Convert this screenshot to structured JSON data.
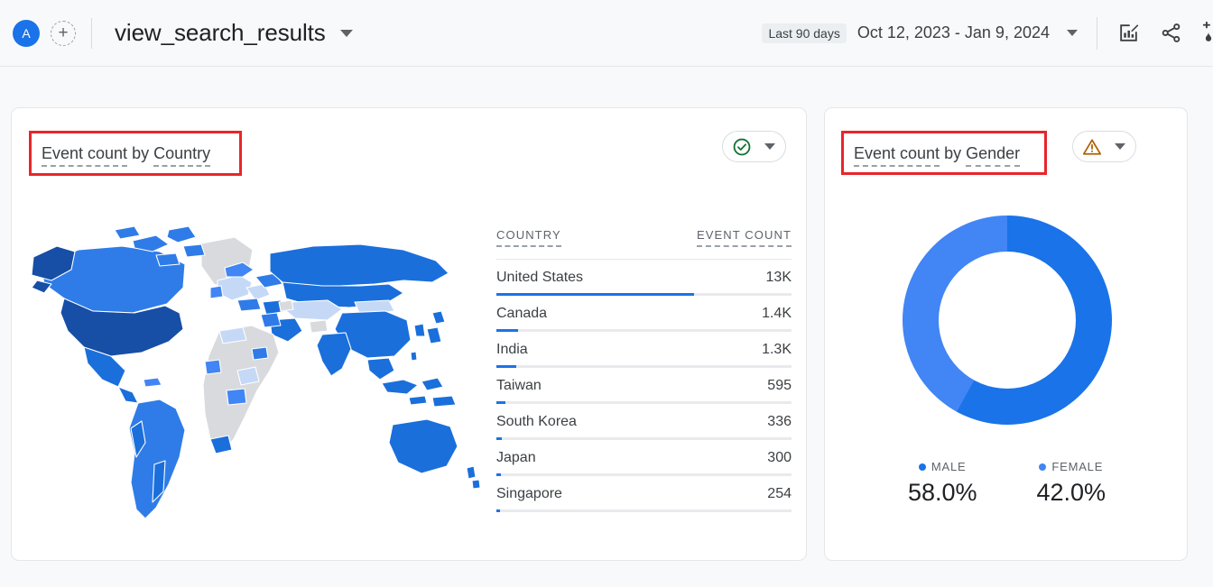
{
  "topbar": {
    "avatar_letter": "A",
    "add_icon": "plus-icon",
    "report_title": "view_search_results",
    "title_caret_icon": "chevron-down-icon",
    "date_badge": "Last 90 days",
    "date_range": "Oct 12, 2023 - Jan 9, 2024",
    "date_caret_icon": "chevron-down-icon",
    "icons": [
      "edit-chart-icon",
      "share-icon",
      "insights-icon"
    ]
  },
  "country_card": {
    "title_part1": "Event count",
    "title_mid": " by ",
    "title_part2": "Country",
    "status_icon": "check-circle-icon",
    "status_color": "#137333",
    "status_caret_icon": "chevron-down-icon",
    "table": {
      "headers": [
        "COUNTRY",
        "EVENT COUNT"
      ],
      "rows": [
        {
          "country": "United States",
          "value": "13K",
          "pct": 67
        },
        {
          "country": "Canada",
          "value": "1.4K",
          "pct": 7.2
        },
        {
          "country": "India",
          "value": "1.3K",
          "pct": 6.7
        },
        {
          "country": "Taiwan",
          "value": "595",
          "pct": 3.1
        },
        {
          "country": "South Korea",
          "value": "336",
          "pct": 1.7
        },
        {
          "country": "Japan",
          "value": "300",
          "pct": 1.5
        },
        {
          "country": "Singapore",
          "value": "254",
          "pct": 1.3
        }
      ]
    }
  },
  "gender_card": {
    "title_part1": "Event count",
    "title_mid": " by ",
    "title_part2": "Gender",
    "status_icon": "warning-triangle-icon",
    "status_color": "#b06000",
    "status_caret_icon": "chevron-down-icon"
  },
  "chart_data": [
    {
      "type": "bar",
      "title": "Event count by Country",
      "categories": [
        "United States",
        "Canada",
        "India",
        "Taiwan",
        "South Korea",
        "Japan",
        "Singapore"
      ],
      "values": [
        13000,
        1400,
        1300,
        595,
        336,
        300,
        254
      ],
      "value_labels": [
        "13K",
        "1.4K",
        "1.3K",
        "595",
        "336",
        "300",
        "254"
      ],
      "xlabel": "COUNTRY",
      "ylabel": "EVENT COUNT",
      "bar_color": "#1a73e8",
      "grid": false
    },
    {
      "type": "pie",
      "title": "Event count by Gender",
      "categories": [
        "MALE",
        "FEMALE"
      ],
      "values": [
        58.0,
        42.0
      ],
      "value_labels": [
        "58.0%",
        "42.0%"
      ],
      "colors": [
        "#1a73e8",
        "#4285f4"
      ],
      "donut": true,
      "legend_position": "bottom"
    },
    {
      "type": "heatmap",
      "title": "Event count by Country (world choropleth)",
      "xlabel": "",
      "ylabel": "",
      "no_data_color": "#d8dadd",
      "scale_colors": [
        "#c5d9f7",
        "#8ab0f0",
        "#4285f4",
        "#1a6fdb",
        "#174ea6"
      ]
    }
  ]
}
